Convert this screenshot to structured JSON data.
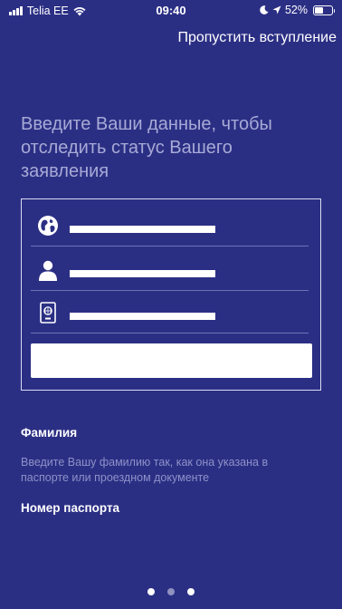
{
  "status_bar": {
    "carrier": "Telia EE",
    "time": "09:40",
    "battery": "52%",
    "battery_level": 0.52
  },
  "header": {
    "skip_label": "Пропустить вступление"
  },
  "main": {
    "headline": "Введите Ваши данные, чтобы отследить статус Вашего заявления",
    "form_fields": [
      {
        "icon": "globe-icon"
      },
      {
        "icon": "person-icon"
      },
      {
        "icon": "passport-icon"
      }
    ],
    "surname_label": "Фамилия",
    "surname_description": "Введите Вашу фамилию так, как она указана в паспорте или проездном документе",
    "passport_label": "Номер паспорта"
  },
  "pagination": {
    "total": 3,
    "active_index": 0
  },
  "colors": {
    "background": "#2b2f84",
    "headline": "#a7aad6",
    "description": "#8d91c7"
  }
}
